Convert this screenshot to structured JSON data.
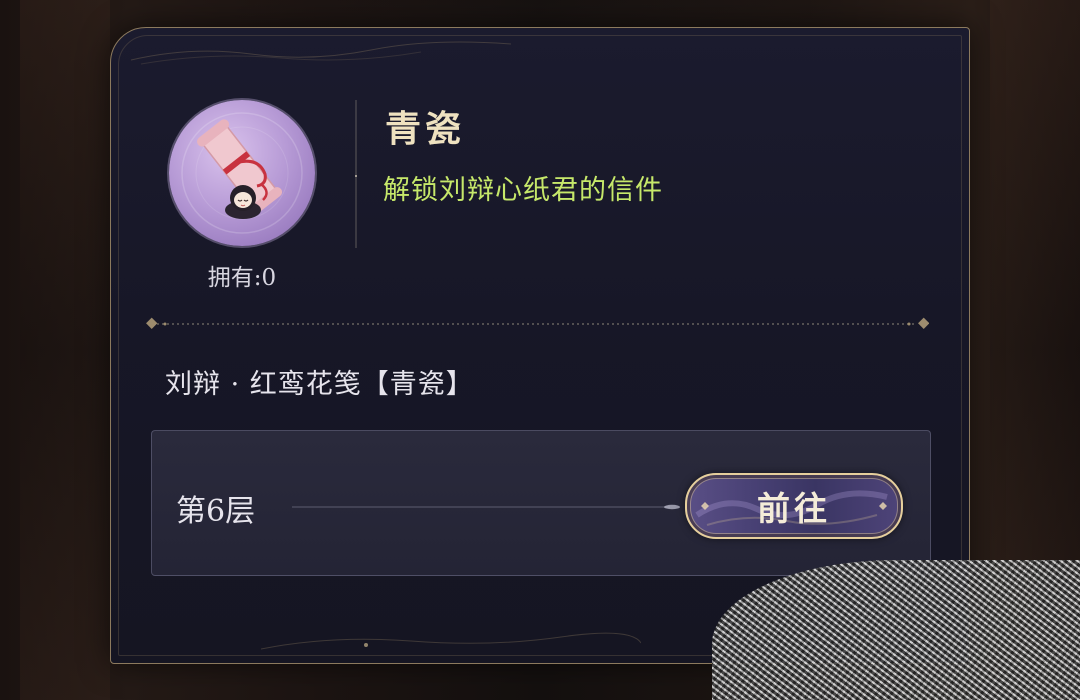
{
  "item": {
    "name": "青瓷",
    "description": "解锁刘辩心纸君的信件",
    "own_count": "拥有:0",
    "icon": "letter-scroll-icon"
  },
  "source": {
    "title": "刘辩 · 红鸾花笺【青瓷】",
    "rows": [
      {
        "floor": "第6层",
        "button_label": "前往"
      }
    ]
  },
  "colors": {
    "panel_bg": "#171727",
    "name_gold": "#efe2c0",
    "desc_green": "#c6e86a",
    "border_gold": "#8c7a5e",
    "button_purple": "#463f72"
  }
}
